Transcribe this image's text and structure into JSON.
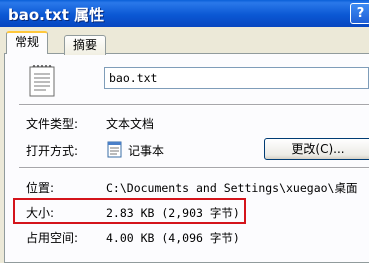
{
  "window": {
    "title": "bao.txt 属性",
    "help_button": "?"
  },
  "tabs": [
    {
      "label": "常规",
      "active": true
    },
    {
      "label": "摘要",
      "active": false
    }
  ],
  "file": {
    "name": "bao.txt"
  },
  "properties": {
    "type_label": "文件类型:",
    "type_value": "文本文档",
    "opens_with_label": "打开方式:",
    "opens_with_value": "记事本",
    "change_button": "更改(C)...",
    "location_label": "位置:",
    "location_value": "C:\\Documents and Settings\\xuegao\\桌面",
    "size_label": "大小:",
    "size_value": "2.83 KB (2,903 字节)",
    "size_on_disk_label": "占用空间:",
    "size_on_disk_value": "4.00 KB (4,096 字节)"
  },
  "icons": {
    "file": "text-file-icon",
    "opens_with": "notepad-icon"
  },
  "colors": {
    "titlebar": "#0b58d4",
    "highlight_box": "#d4141b",
    "dialog_bg": "#ece9d8"
  }
}
